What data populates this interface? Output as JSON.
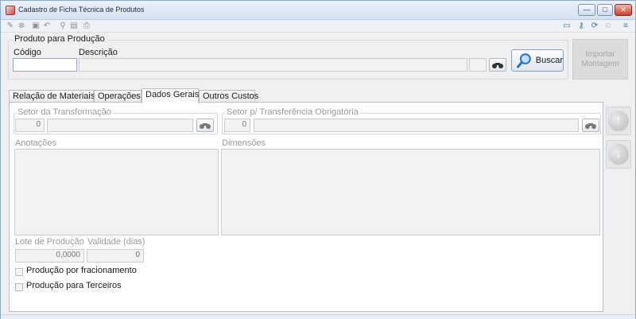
{
  "window": {
    "title": "Cadastro de Ficha Técnica de Produtos"
  },
  "produto": {
    "group_title": "Produto para Produção",
    "codigo_label": "Código",
    "codigo_value": "",
    "descricao_label": "Descrição",
    "descricao_value": "",
    "buscar_label": "Buscar",
    "importar_label_line1": "Importar",
    "importar_label_line2": "Montagem"
  },
  "tabs": [
    {
      "label": "Relação de Materiais"
    },
    {
      "label": "Operações"
    },
    {
      "label": "Dados Gerais"
    },
    {
      "label": "Outros Custos"
    }
  ],
  "dados_gerais": {
    "setor_transformacao_label": "Setor da Transformação",
    "setor_transformacao_code": "0",
    "setor_transformacao_desc": "",
    "setor_transferencia_label": "Setor p/ Transferência Obrigatória",
    "setor_transferencia_code": "0",
    "setor_transferencia_desc": "",
    "anotacoes_label": "Anotações",
    "dimensoes_label": "Dimensões",
    "lote_label": "Lote de Produção",
    "lote_value": "0,0000",
    "validade_label": "Validade (dias)",
    "validade_value": "0",
    "cb_fracionamento_label": "Produção por fracionamento",
    "cb_terceiros_label": "Produção para Terceiros"
  },
  "icons": {
    "toolbar_left": [
      "new-icon",
      "cancel-icon",
      "save-icon",
      "undo-icon",
      "search-icon",
      "print-preview-icon",
      "print-icon"
    ],
    "toolbar_right": [
      "window-icon",
      "key-icon",
      "refresh-icon",
      "user-icon",
      "exit-icon"
    ]
  }
}
